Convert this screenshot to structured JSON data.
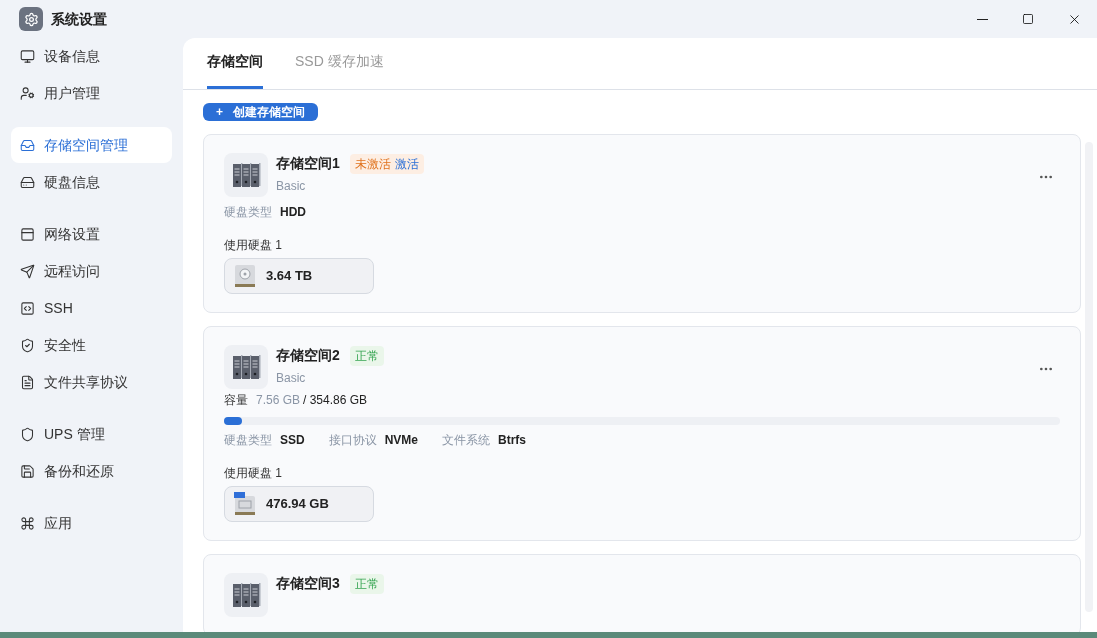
{
  "window": {
    "title": "系统设置"
  },
  "sidebar": {
    "groups": [
      [
        {
          "label": "设备信息",
          "selected": false
        },
        {
          "label": "用户管理",
          "selected": false
        }
      ],
      [
        {
          "label": "存储空间管理",
          "selected": true
        },
        {
          "label": "硬盘信息",
          "selected": false
        }
      ],
      [
        {
          "label": "网络设置",
          "selected": false
        },
        {
          "label": "远程访问",
          "selected": false
        },
        {
          "label": "SSH",
          "selected": false
        },
        {
          "label": "安全性",
          "selected": false
        },
        {
          "label": "文件共享协议",
          "selected": false
        }
      ],
      [
        {
          "label": "UPS 管理",
          "selected": false
        },
        {
          "label": "备份和还原",
          "selected": false
        }
      ],
      [
        {
          "label": "应用",
          "selected": false
        }
      ]
    ]
  },
  "tabs": [
    {
      "label": "存储空间",
      "selected": true
    },
    {
      "label": "SSD 缓存加速",
      "selected": false
    }
  ],
  "create_button": {
    "icon_text": "+",
    "label": "创建存储空间"
  },
  "cards": [
    {
      "title": "存储空间1",
      "status": {
        "text": "未激活",
        "kind": "warning",
        "action": "激活"
      },
      "subtitle": "Basic",
      "properties": [
        {
          "label": "硬盘类型",
          "value": "HDD"
        }
      ],
      "disks_label": "使用硬盘 1",
      "disks": [
        {
          "kind": "hdd",
          "size": "3.64 TB"
        }
      ]
    },
    {
      "title": "存储空间2",
      "status": {
        "text": "正常",
        "kind": "ok"
      },
      "subtitle": "Basic",
      "capacity": {
        "label": "容量",
        "used": "7.56 GB",
        "total": "/ 354.86 GB",
        "level": 0.022
      },
      "properties": [
        {
          "label": "硬盘类型",
          "value": "SSD"
        },
        {
          "label": "接口协议",
          "value": "NVMe"
        },
        {
          "label": "文件系统",
          "value": "Btrfs"
        }
      ],
      "disks_label": "使用硬盘 1",
      "disks": [
        {
          "kind": "ssd",
          "size": "476.94 GB"
        }
      ]
    },
    {
      "title": "存储空间3",
      "status": {
        "text": "正常",
        "kind": "ok"
      }
    }
  ]
}
